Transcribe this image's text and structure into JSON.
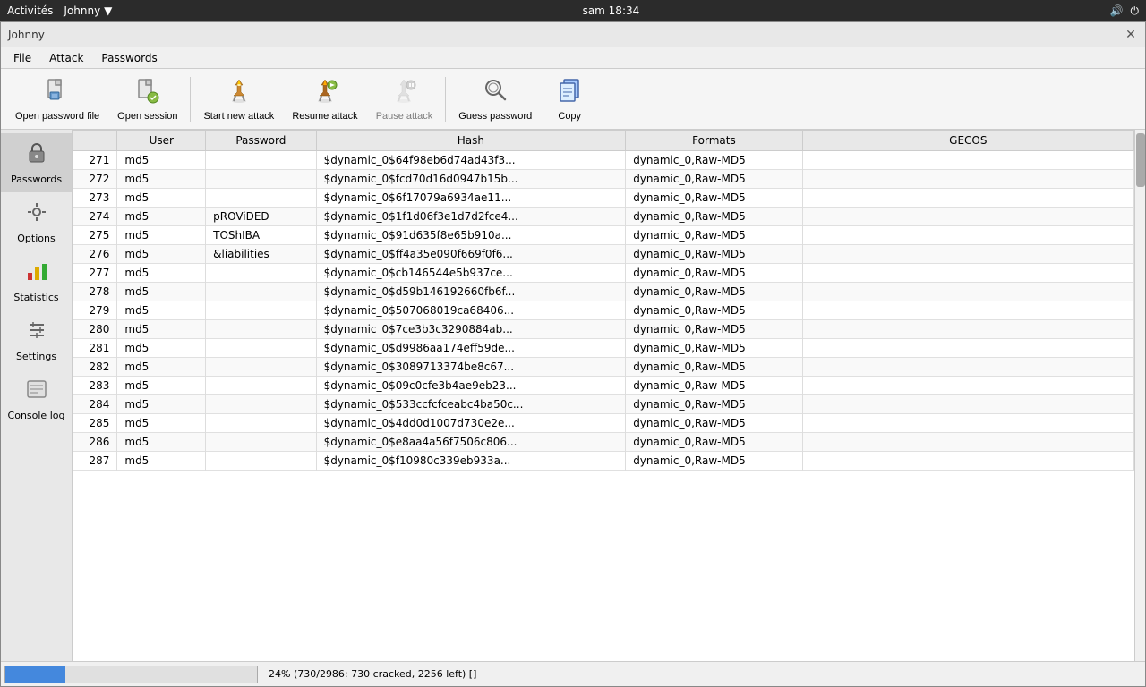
{
  "system_bar": {
    "activities": "Activités",
    "app_name": "Johnny",
    "arrow": "▼",
    "time": "sam 18:34",
    "volume_icon": "🔊",
    "power_icon": "⏻"
  },
  "window": {
    "title": "Johnny",
    "close_icon": "✕"
  },
  "menu": {
    "items": [
      "File",
      "Attack",
      "Passwords"
    ]
  },
  "toolbar": {
    "buttons": [
      {
        "id": "open-password-file",
        "label": "Open password file",
        "icon": "file",
        "disabled": false
      },
      {
        "id": "open-session",
        "label": "Open session",
        "icon": "session",
        "disabled": false
      },
      {
        "id": "start-new-attack",
        "label": "Start new attack",
        "icon": "attack-start",
        "disabled": false
      },
      {
        "id": "resume-attack",
        "label": "Resume attack",
        "icon": "attack-resume",
        "disabled": false
      },
      {
        "id": "pause-attack",
        "label": "Pause attack",
        "icon": "attack-pause",
        "disabled": true
      },
      {
        "id": "guess-password",
        "label": "Guess password",
        "icon": "guess",
        "disabled": false
      },
      {
        "id": "copy",
        "label": "Copy",
        "icon": "copy",
        "disabled": false
      }
    ]
  },
  "sidebar": {
    "items": [
      {
        "id": "passwords",
        "label": "Passwords",
        "icon": "🔒",
        "active": true
      },
      {
        "id": "options",
        "label": "Options",
        "icon": "⚙"
      },
      {
        "id": "statistics",
        "label": "Statistics",
        "icon": "📊"
      },
      {
        "id": "settings",
        "label": "Settings",
        "icon": "🔧"
      },
      {
        "id": "console-log",
        "label": "Console log",
        "icon": "📋"
      }
    ]
  },
  "table": {
    "columns": [
      "",
      "User",
      "Password",
      "Hash",
      "Formats",
      "GECOS"
    ],
    "rows": [
      {
        "num": "271",
        "user": "md5",
        "password": "",
        "hash": "$dynamic_0$64f98eb6d74ad43f3...",
        "format": "dynamic_0,Raw-MD5",
        "gecos": ""
      },
      {
        "num": "272",
        "user": "md5",
        "password": "",
        "hash": "$dynamic_0$fcd70d16d0947b15b...",
        "format": "dynamic_0,Raw-MD5",
        "gecos": ""
      },
      {
        "num": "273",
        "user": "md5",
        "password": "",
        "hash": "$dynamic_0$6f17079a6934ae11...",
        "format": "dynamic_0,Raw-MD5",
        "gecos": ""
      },
      {
        "num": "274",
        "user": "md5",
        "password": "pROViDED",
        "hash": "$dynamic_0$1f1d06f3e1d7d2fce4...",
        "format": "dynamic_0,Raw-MD5",
        "gecos": ""
      },
      {
        "num": "275",
        "user": "md5",
        "password": "TOShIBA",
        "hash": "$dynamic_0$91d635f8e65b910a...",
        "format": "dynamic_0,Raw-MD5",
        "gecos": ""
      },
      {
        "num": "276",
        "user": "md5",
        "password": "&liabilities",
        "hash": "$dynamic_0$ff4a35e090f669f0f6...",
        "format": "dynamic_0,Raw-MD5",
        "gecos": ""
      },
      {
        "num": "277",
        "user": "md5",
        "password": "",
        "hash": "$dynamic_0$cb146544e5b937ce...",
        "format": "dynamic_0,Raw-MD5",
        "gecos": ""
      },
      {
        "num": "278",
        "user": "md5",
        "password": "",
        "hash": "$dynamic_0$d59b146192660fb6f...",
        "format": "dynamic_0,Raw-MD5",
        "gecos": ""
      },
      {
        "num": "279",
        "user": "md5",
        "password": "",
        "hash": "$dynamic_0$507068019ca68406...",
        "format": "dynamic_0,Raw-MD5",
        "gecos": ""
      },
      {
        "num": "280",
        "user": "md5",
        "password": "",
        "hash": "$dynamic_0$7ce3b3c3290884ab...",
        "format": "dynamic_0,Raw-MD5",
        "gecos": ""
      },
      {
        "num": "281",
        "user": "md5",
        "password": "",
        "hash": "$dynamic_0$d9986aa174eff59de...",
        "format": "dynamic_0,Raw-MD5",
        "gecos": ""
      },
      {
        "num": "282",
        "user": "md5",
        "password": "",
        "hash": "$dynamic_0$3089713374be8c67...",
        "format": "dynamic_0,Raw-MD5",
        "gecos": ""
      },
      {
        "num": "283",
        "user": "md5",
        "password": "",
        "hash": "$dynamic_0$09c0cfe3b4ae9eb23...",
        "format": "dynamic_0,Raw-MD5",
        "gecos": ""
      },
      {
        "num": "284",
        "user": "md5",
        "password": "",
        "hash": "$dynamic_0$533ccfcfceabc4ba50c...",
        "format": "dynamic_0,Raw-MD5",
        "gecos": ""
      },
      {
        "num": "285",
        "user": "md5",
        "password": "",
        "hash": "$dynamic_0$4dd0d1007d730e2e...",
        "format": "dynamic_0,Raw-MD5",
        "gecos": ""
      },
      {
        "num": "286",
        "user": "md5",
        "password": "",
        "hash": "$dynamic_0$e8aa4a56f7506c806...",
        "format": "dynamic_0,Raw-MD5",
        "gecos": ""
      },
      {
        "num": "287",
        "user": "md5",
        "password": "",
        "hash": "$dynamic_0$f10980c339eb933a...",
        "format": "dynamic_0,Raw-MD5",
        "gecos": ""
      }
    ]
  },
  "status_bar": {
    "progress_percent": 24,
    "progress_text": "24% (730/2986: 730 cracked, 2256 left) []"
  }
}
